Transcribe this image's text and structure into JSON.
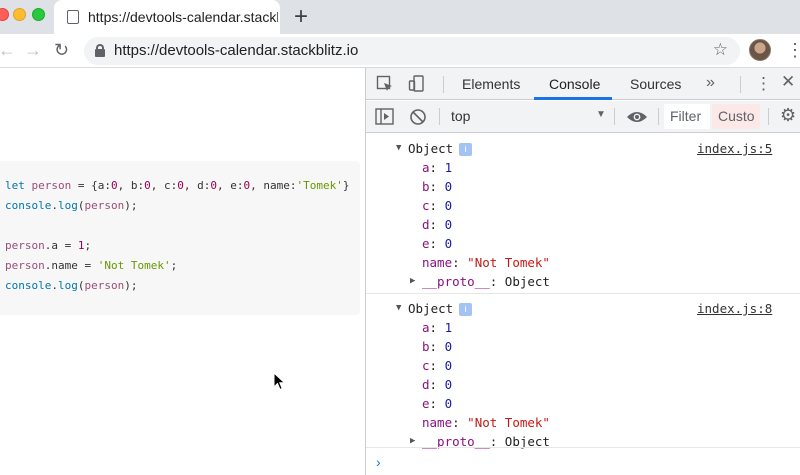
{
  "browser": {
    "tab_title": "https://devtools-calendar.stackblitz.io",
    "new_tab_symbol": "+",
    "url": "https://devtools-calendar.stackblitz.io"
  },
  "page": {
    "code_lines": [
      "let person = {a:0, b:0, c:0, d:0, e:0, name:'Tomek'}",
      "console.log(person);",
      "",
      "person.a = 1;",
      "person.name = 'Not Tomek';",
      "console.log(person);"
    ]
  },
  "devtools": {
    "tabs": [
      "Elements",
      "Console",
      "Sources"
    ],
    "active_tab": "Console",
    "more_tabs_symbol": "»",
    "context": "top",
    "filter_placeholder": "Filter",
    "levels_label": "Custo",
    "accent_color": "#1a73e8"
  },
  "console": {
    "entries": [
      {
        "label": "Object",
        "source": "index.js:5",
        "props": [
          {
            "key": "a",
            "value": "1"
          },
          {
            "key": "b",
            "value": "0"
          },
          {
            "key": "c",
            "value": "0"
          },
          {
            "key": "d",
            "value": "0"
          },
          {
            "key": "e",
            "value": "0"
          },
          {
            "key": "name",
            "value": "\"Not Tomek\""
          }
        ],
        "proto_key": "__proto__",
        "proto_value": "Object"
      },
      {
        "label": "Object",
        "source": "index.js:8",
        "props": [
          {
            "key": "a",
            "value": "1"
          },
          {
            "key": "b",
            "value": "0"
          },
          {
            "key": "c",
            "value": "0"
          },
          {
            "key": "d",
            "value": "0"
          },
          {
            "key": "e",
            "value": "0"
          },
          {
            "key": "name",
            "value": "\"Not Tomek\""
          }
        ],
        "proto_key": "__proto__",
        "proto_value": "Object"
      }
    ],
    "info_badge": "i",
    "prompt_symbol": "›"
  }
}
